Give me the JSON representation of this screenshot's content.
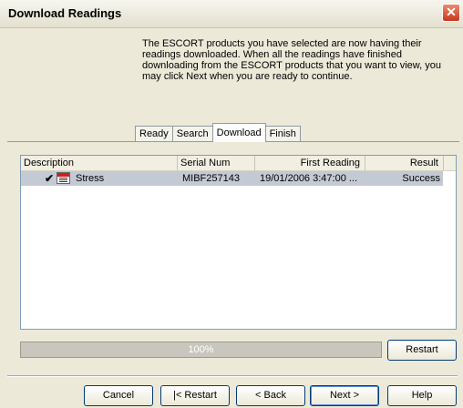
{
  "window": {
    "title": "Download Readings",
    "close_label": "✕"
  },
  "instructions": "The ESCORT products you have selected are now having their readings downloaded. When all the readings have finished downloading from the ESCORT products that you want to view, you may click Next when you are ready to continue.",
  "tabs": [
    {
      "label": "Ready",
      "active": false
    },
    {
      "label": "Search",
      "active": false
    },
    {
      "label": "Download",
      "active": true
    },
    {
      "label": "Finish",
      "active": false
    }
  ],
  "list": {
    "columns": [
      "Description",
      "Serial Num",
      "First Reading",
      "Result"
    ],
    "rows": [
      {
        "checked": "✔",
        "icon": "calendar-document-icon",
        "icon_label": "MIN",
        "description": "Stress",
        "serial": "MIBF257143",
        "first_reading": "19/01/2006  3:47:00 ...",
        "result": "Success"
      }
    ]
  },
  "progress": {
    "value": 100,
    "label": "100%"
  },
  "buttons": {
    "restart_side": "Restart",
    "cancel": "Cancel",
    "k_restart": "|< Restart",
    "back": "< Back",
    "next": "Next >",
    "help": "Help"
  },
  "colors": {
    "selected_row": "#c3cad4",
    "close_button": "#c8391f"
  }
}
